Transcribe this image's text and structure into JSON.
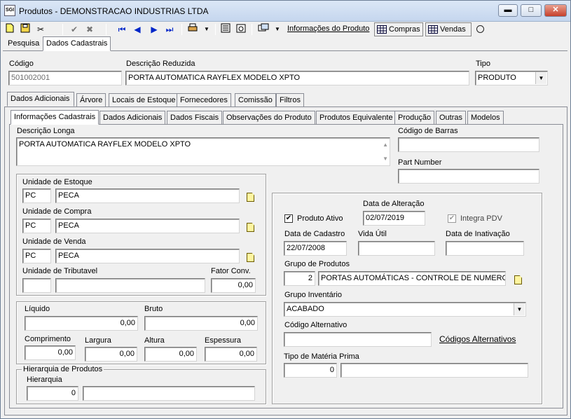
{
  "window": {
    "title": "Produtos - DEMONSTRACAO INDUSTRIAS LTDA",
    "app_icon_text": "SGI"
  },
  "toolbar": {
    "informacoes_label": "Informações do Produto",
    "compras_label": "Compras",
    "vendas_label": "Vendas"
  },
  "top_tabs": [
    "Pesquisa",
    "Dados Cadastrais"
  ],
  "header": {
    "codigo_label": "Código",
    "codigo_value": "501002001",
    "descricao_label": "Descrição Reduzida",
    "descricao_value": "PORTA AUTOMATICA RAYFLEX MODELO XPTO",
    "tipo_label": "Tipo",
    "tipo_value": "PRODUTO"
  },
  "tabs_level1": [
    "Dados Adicionais",
    "Árvore",
    "Locais de Estoque",
    "Fornecedores",
    "Comissão",
    "Filtros"
  ],
  "tabs_level2": [
    "Informações Cadastrais",
    "Dados Adicionais",
    "Dados Fiscais",
    "Observações do Produto",
    "Produtos Equivalente",
    "Produção",
    "Outras",
    "Modelos"
  ],
  "form": {
    "descricao_longa_label": "Descrição Longa",
    "descricao_longa_value": "PORTA AUTOMATICA RAYFLEX MODELO XPTO",
    "codigo_barras_label": "Código de Barras",
    "codigo_barras_value": "",
    "part_number_label": "Part Number",
    "part_number_value": "",
    "un_estoque_label": "Unidade de Estoque",
    "un_estoque_code": "PC",
    "un_estoque_desc": "PECA",
    "un_compra_label": "Unidade de Compra",
    "un_compra_code": "PC",
    "un_compra_desc": "PECA",
    "un_venda_label": "Unidade de Venda",
    "un_venda_code": "PC",
    "un_venda_desc": "PECA",
    "un_trib_label": "Unidade de Tributavel",
    "un_trib_code": "",
    "un_trib_desc": "",
    "fator_label": "Fator Conv.",
    "fator_value": "0,00",
    "liquido_label": "Líquido",
    "liquido_value": "0,00",
    "bruto_label": "Bruto",
    "bruto_value": "0,00",
    "comprimento_label": "Comprimento",
    "comprimento_value": "0,00",
    "largura_label": "Largura",
    "largura_value": "0,00",
    "altura_label": "Altura",
    "altura_value": "0,00",
    "espessura_label": "Espessura",
    "espessura_value": "0,00",
    "hierarquia_group": "Hierarquia de Produtos",
    "hierarquia_label": "Hierarquia",
    "hierarquia_value": "0",
    "hierarquia_desc": "",
    "data_alteracao_label": "Data de Alteração",
    "data_alteracao_value": "02/07/2019",
    "produto_ativo_label": "Produto Ativo",
    "integra_pdv_label": "Integra PDV",
    "data_cadastro_label": "Data de Cadastro",
    "data_cadastro_value": "22/07/2008",
    "vida_util_label": "Vida Útil",
    "vida_util_value": "",
    "data_inativacao_label": "Data de Inativação",
    "data_inativacao_value": "",
    "grupo_produtos_label": "Grupo de Produtos",
    "grupo_produtos_code": "2",
    "grupo_produtos_desc": "PORTAS AUTOMÁTICAS - CONTROLE DE NUMERO DE",
    "grupo_inventario_label": "Grupo Inventário",
    "grupo_inventario_value": "ACABADO",
    "codigo_alt_label": "Código Alternativo",
    "codigo_alt_value": "",
    "codigos_alt_link": "Códigos Alternativos",
    "tipo_mp_label": "Tipo de Matéria Prima",
    "tipo_mp_code": "0",
    "tipo_mp_desc": ""
  }
}
